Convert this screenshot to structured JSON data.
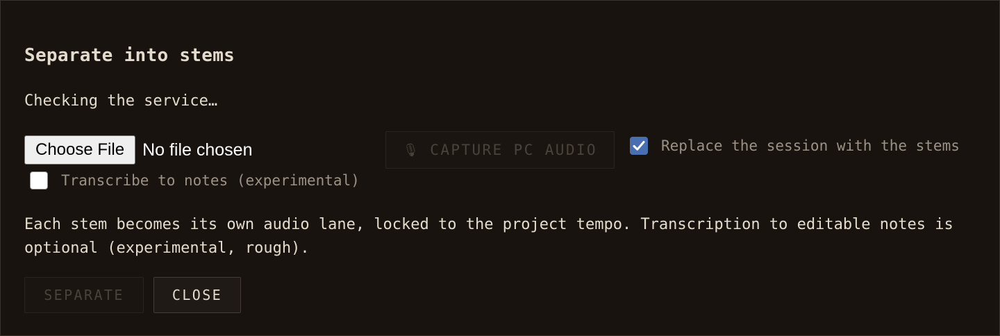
{
  "dialog": {
    "title": "Separate into stems",
    "status": "Checking the service…",
    "file_input": {
      "button_label": "Choose File",
      "status_text": "No file chosen"
    },
    "capture_button": {
      "icon": "mic-icon",
      "label": "CAPTURE PC AUDIO",
      "enabled": false
    },
    "replace_session": {
      "label": "Replace the session with the stems",
      "checked": true
    },
    "transcribe": {
      "label": "Transcribe to notes (experimental)",
      "checked": false
    },
    "description": "Each stem becomes its own audio lane, locked to the project tempo. Transcription to editable notes is optional (experimental, rough).",
    "buttons": {
      "separate_label": "SEPARATE",
      "separate_enabled": false,
      "close_label": "CLOSE"
    }
  },
  "colors": {
    "background": "#18130f",
    "text": "#e3dccd",
    "muted_text": "#9b9285",
    "disabled_text": "#4a433b",
    "checkbox_accent": "#4a6fb0"
  }
}
